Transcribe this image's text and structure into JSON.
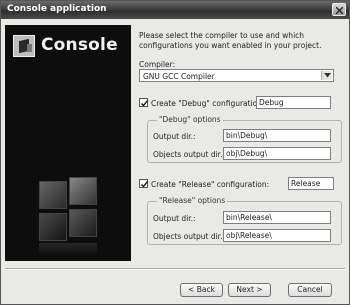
{
  "window": {
    "title": "Console application"
  },
  "sidebar": {
    "logo_text": "Console"
  },
  "intro": "Please select the compiler to use and which configurations you want enabled in your project.",
  "compiler": {
    "label": "Compiler:",
    "selected": "GNU GCC Compiler"
  },
  "debug": {
    "checkbox_label": "Create \"Debug\" configuration:",
    "checked": true,
    "name": "Debug",
    "group_title": "\"Debug\" options",
    "output_dir_label": "Output dir.:",
    "output_dir": "bin\\Debug\\",
    "objects_dir_label": "Objects output dir.:",
    "objects_dir": "obj\\Debug\\"
  },
  "release": {
    "checkbox_label": "Create \"Release\" configuration:",
    "checked": true,
    "name": "Release",
    "group_title": "\"Release\" options",
    "output_dir_label": "Output dir.:",
    "output_dir": "bin\\Release\\",
    "objects_dir_label": "Objects output dir.:",
    "objects_dir": "obj\\Release\\"
  },
  "buttons": {
    "back": "< Back",
    "next": "Next >",
    "cancel": "Cancel"
  }
}
